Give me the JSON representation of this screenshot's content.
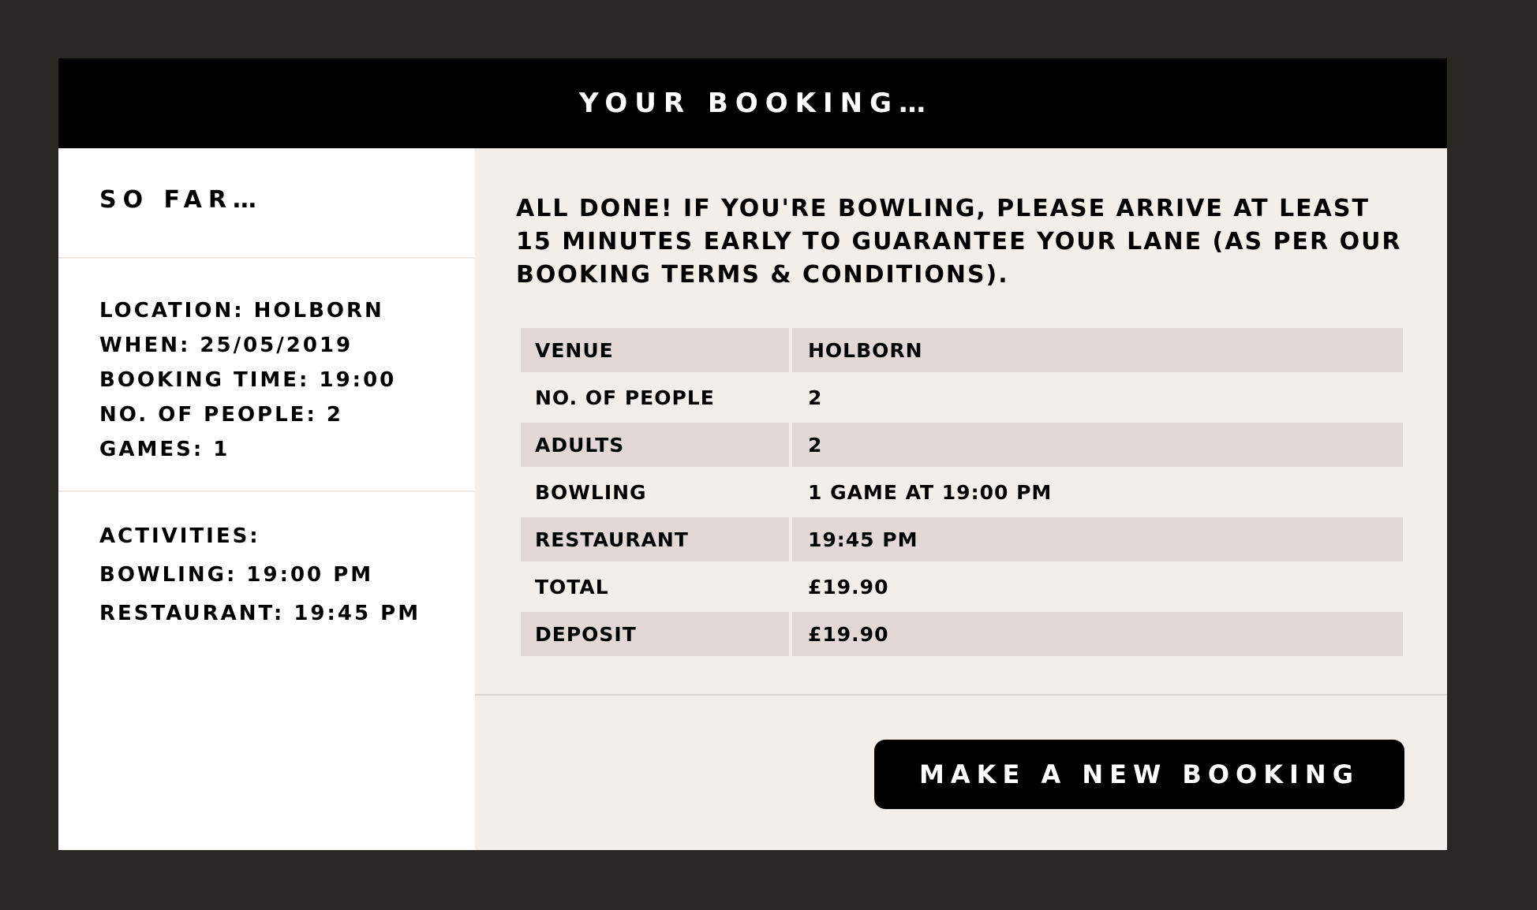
{
  "header": {
    "title": "YOUR BOOKING…"
  },
  "summary": {
    "title": "SO FAR…",
    "details": [
      "LOCATION: HOLBORN",
      "WHEN: 25/05/2019",
      "BOOKING TIME: 19:00",
      "NO. OF PEOPLE: 2",
      "GAMES: 1"
    ],
    "activities_label": "ACTIVITIES:",
    "activities": [
      "BOWLING: 19:00 PM",
      "RESTAURANT: 19:45 PM"
    ]
  },
  "confirmation": {
    "message": "ALL DONE! IF YOU'RE BOWLING, PLEASE ARRIVE AT LEAST 15 MINUTES EARLY TO GUARANTEE YOUR LANE (AS PER OUR BOOKING TERMS & CONDITIONS).",
    "rows": [
      {
        "label": "VENUE",
        "value": "HOLBORN"
      },
      {
        "label": "NO. OF PEOPLE",
        "value": "2"
      },
      {
        "label": "ADULTS",
        "value": "2"
      },
      {
        "label": "BOWLING",
        "value": "1 GAME AT 19:00 PM"
      },
      {
        "label": "RESTAURANT",
        "value": "19:45 PM"
      },
      {
        "label": "TOTAL",
        "value": "£19.90"
      },
      {
        "label": "DEPOSIT",
        "value": "£19.90"
      }
    ]
  },
  "actions": {
    "new_booking_label": "MAKE A NEW BOOKING"
  },
  "colors": {
    "backdrop": "#282724",
    "header": "#000000",
    "panel_light": "#f2efeb",
    "row_shade": "#e2d9d6",
    "button": "#000000"
  }
}
